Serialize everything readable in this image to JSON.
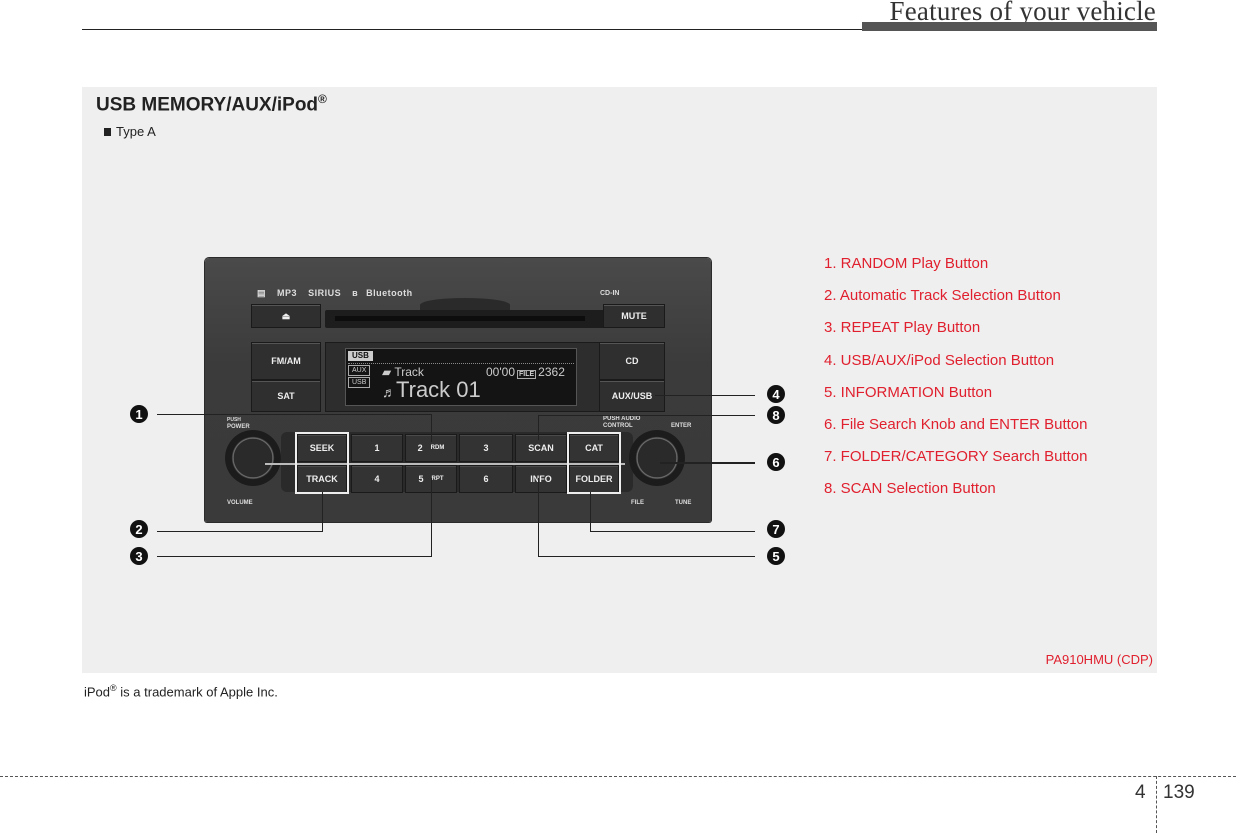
{
  "header": {
    "title": "Features of your vehicle"
  },
  "section": {
    "title": "USB MEMORY/AUX/iPod",
    "title_mark": "®",
    "subtitle": "Type A",
    "figure_code": "PA910HMU (CDP)"
  },
  "radio": {
    "logos": [
      "disc",
      "MP3",
      "SIRIUS",
      "Bluetooth"
    ],
    "eject_icon": "⏏",
    "cd_in_label": "CD-IN",
    "mute_label": "MUTE",
    "fm_am_label": "FM/AM",
    "sat_label": "SAT",
    "cd_label": "CD",
    "aux_usb_label": "AUX/USB",
    "lcd": {
      "mode": "USB",
      "tag_aux": "AUX",
      "tag_usb": "USB",
      "folder": "Track",
      "time": "00'00",
      "file_tag": "FILE",
      "file_no": "2362",
      "track": "Track 01"
    },
    "push_power": "PUSH",
    "power": "POWER",
    "volume": "VOLUME",
    "push_audio": "PUSH AUDIO",
    "control": "CONTROL",
    "enter": "ENTER",
    "file": "FILE",
    "tune": "TUNE",
    "seek": "SEEK",
    "track_btn": "TRACK",
    "presets": [
      {
        "num": "1",
        "sub": ""
      },
      {
        "num": "2",
        "sub": "RDM"
      },
      {
        "num": "3",
        "sub": ""
      },
      {
        "num": "4",
        "sub": ""
      },
      {
        "num": "5",
        "sub": "RPT"
      },
      {
        "num": "6",
        "sub": ""
      }
    ],
    "scan": "SCAN",
    "info": "INFO",
    "cat": "CAT",
    "folder": "FOLDER"
  },
  "callouts": [
    "1",
    "2",
    "3",
    "4",
    "5",
    "6",
    "7",
    "8"
  ],
  "legend": [
    "1. RANDOM Play Button",
    "2. Automatic Track Selection Button",
    "3. REPEAT Play Button",
    "4. USB/AUX/iPod Selection Button",
    "5. INFORMATION Button",
    "6. File Search Knob and ENTER Button",
    "7. FOLDER/CATEGORY Search Button",
    "8. SCAN Selection Button"
  ],
  "trademark": {
    "text_a": "iPod",
    "mark": "®",
    "text_b": " is a trademark of Apple Inc."
  },
  "footer": {
    "chapter": "4",
    "page": "139"
  }
}
